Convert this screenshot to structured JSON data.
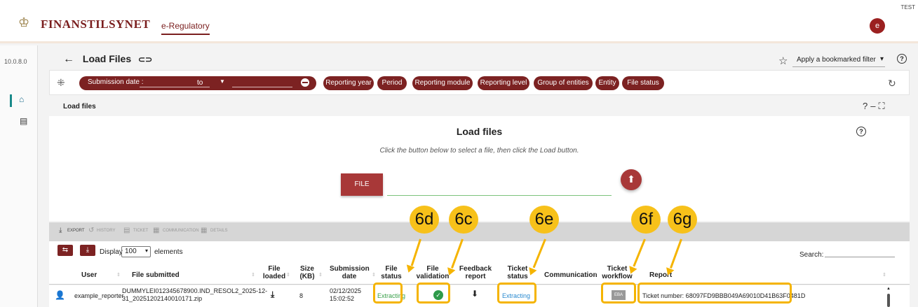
{
  "header": {
    "brand": "FINANSTILSYNET",
    "tab": "e-Regulatory",
    "env_badge": "TEST",
    "avatar_letter": "e",
    "crown_icon": "crown-icon"
  },
  "sidebar": {
    "version": "10.0.8.0",
    "items": [
      {
        "icon": "home-icon",
        "glyph": "⌂"
      },
      {
        "icon": "chat-icon",
        "glyph": "▤"
      }
    ]
  },
  "page": {
    "title": "Load Files",
    "back_glyph": "←",
    "link_glyph": "⊂⊃",
    "bookmark_filter": "Apply a bookmarked filter",
    "help_glyph": "?"
  },
  "filters": {
    "submission_date_label": "Submission date :",
    "to_label": "to",
    "chips": [
      "Reporting year",
      "Period",
      "Reporting module",
      "Reporting level",
      "Group of entities",
      "Entity",
      "File status"
    ]
  },
  "panel": {
    "header_title": "Load files",
    "title": "Load files",
    "hint": "Click the button below to select a file, then click the Load button.",
    "file_button": "FILE"
  },
  "toolbar": {
    "export": "EXPORT",
    "history": "HISTORY",
    "ticket": "TICKET",
    "communication": "COMMUNICATION",
    "details": "DETAILS"
  },
  "table_controls": {
    "display_label": "Display",
    "display_value": "100",
    "elements_label": "elements",
    "search_label": "Search:"
  },
  "table": {
    "headers": {
      "user": "User",
      "file_submitted": "File submitted",
      "file_loaded_1": "File",
      "file_loaded_2": "loaded",
      "size_1": "Size",
      "size_2": "(KB)",
      "submission_date_1": "Submission",
      "submission_date_2": "date",
      "file_status_1": "File",
      "file_status_2": "status",
      "file_validation_1": "File",
      "file_validation_2": "validation",
      "feedback_1": "Feedback",
      "feedback_2": "report",
      "ticket_status_1": "Ticket",
      "ticket_status_2": "status",
      "communication": "Communication",
      "ticket_workflow_1": "Ticket",
      "ticket_workflow_2": "workflow",
      "report": "Report"
    },
    "rows": [
      {
        "user": "example_reporter",
        "file_1": "DUMMYLEI012345678900.IND_RESOL2_2025-12-",
        "file_2": "31_20251202140010171.zip",
        "size": "8",
        "date_1": "02/12/2025",
        "date_2": "15:02:52",
        "file_status": "Extracting",
        "ticket_status": "Extracting",
        "workflow_icon": "EBA",
        "report": "Ticket number: 68097FD9BBB049A69010D41B63F0481D"
      }
    ]
  },
  "annotations": [
    "6d",
    "6c",
    "6e",
    "6f",
    "6g"
  ],
  "colors": {
    "brand": "#7a1e1e",
    "chip": "#7c2222",
    "highlight": "#f5b400",
    "status_green": "#3aa04a",
    "status_blue": "#2a8ad0"
  }
}
